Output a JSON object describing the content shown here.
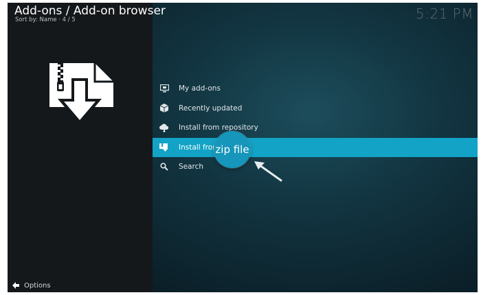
{
  "header": {
    "title": "Add-ons / Add-on browser",
    "subtitle": "Sort by: Name  ·  4 / 5",
    "clock": "5:21 PM"
  },
  "menu": {
    "items": [
      {
        "label": "My add-ons",
        "icon": "monitor-icon",
        "selected": false
      },
      {
        "label": "Recently updated",
        "icon": "box-icon",
        "selected": false
      },
      {
        "label": "Install from repository",
        "icon": "cloud-download-icon",
        "selected": false
      },
      {
        "label": "Install from",
        "icon": "zip-file-icon",
        "selected": true
      },
      {
        "label": "Search",
        "icon": "search-icon",
        "selected": false
      }
    ],
    "magnifier_text": "zip file"
  },
  "footer": {
    "options_label": "Options"
  },
  "colors": {
    "left_panel": "#15181b",
    "highlight": "#12a3c6",
    "background_teal": "#123541"
  }
}
